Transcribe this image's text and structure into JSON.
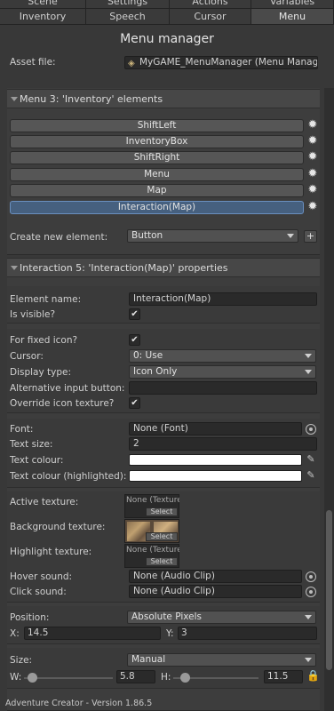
{
  "tabs": {
    "row1": [
      "Scene",
      "Settings",
      "Actions",
      "Variables"
    ],
    "row2": [
      "Inventory",
      "Speech",
      "Cursor",
      "Menu"
    ]
  },
  "title": "Menu manager",
  "asset_file": {
    "label": "Asset file:",
    "value": "MyGAME_MenuManager (Menu Manager)"
  },
  "menu_section": {
    "header": "Menu 3: 'Inventory' elements",
    "elements": [
      "ShiftLeft",
      "InventoryBox",
      "ShiftRight",
      "Menu",
      "Map",
      "Interaction(Map)"
    ],
    "selected": "Interaction(Map)",
    "create_label": "Create new element:",
    "create_value": "Button",
    "add_symbol": "+"
  },
  "props": {
    "header": "Interaction 5: 'Interaction(Map)' properties",
    "element_name_label": "Element name:",
    "element_name_value": "Interaction(Map)",
    "is_visible_label": "Is visible?",
    "check": "✔",
    "for_fixed_icon_label": "For fixed icon?",
    "cursor_label": "Cursor:",
    "cursor_value": "0: Use",
    "display_type_label": "Display type:",
    "display_type_value": "Icon Only",
    "alt_input_label": "Alternative input button:",
    "alt_input_value": "",
    "override_label": "Override icon texture?",
    "font_label": "Font:",
    "font_value": "None (Font)",
    "text_size_label": "Text size:",
    "text_size_value": "2",
    "text_colour_label": "Text colour:",
    "text_colour_hl_label": "Text colour (highlighted):",
    "text_colour": "#ffffff",
    "active_texture_label": "Active texture:",
    "background_texture_label": "Background texture:",
    "highlight_texture_label": "Highlight texture:",
    "texture_none": "None (Texture)",
    "select_label": "Select",
    "hover_sound_label": "Hover sound:",
    "click_sound_label": "Click sound:",
    "audio_none": "None (Audio Clip)",
    "position_label": "Position:",
    "position_value": "Absolute Pixels",
    "x_label": "X:",
    "x_value": "14.5",
    "y_label": "Y:",
    "y_value": "3",
    "size_label": "Size:",
    "size_value": "Manual",
    "w_label": "W:",
    "w_value": "5.8",
    "h_label": "H:",
    "h_value": "11.5"
  },
  "footer": "Adventure Creator - Version 1.86.5",
  "colors": {
    "accent_selected": "#46607f",
    "lock": "#e0a020"
  }
}
